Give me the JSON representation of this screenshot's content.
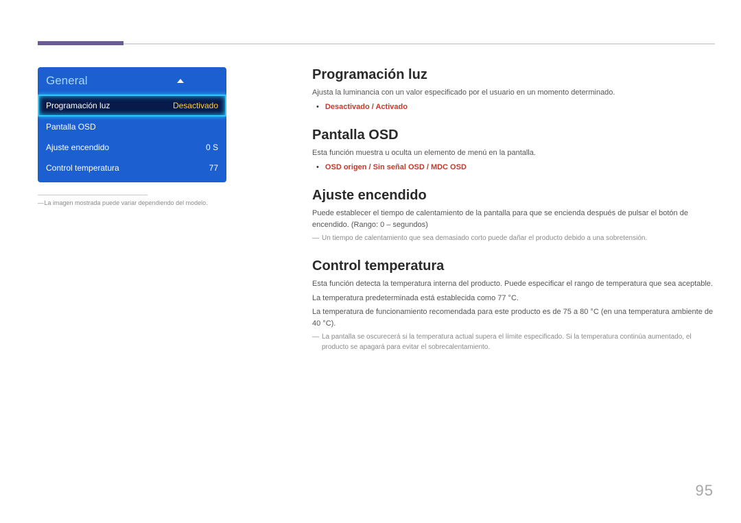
{
  "panel": {
    "title": "General",
    "rows": [
      {
        "label": "Programación luz",
        "value": "Desactivado"
      },
      {
        "label": "Pantalla OSD",
        "value": ""
      },
      {
        "label": "Ajuste encendido",
        "value": "0 S"
      },
      {
        "label": "Control temperatura",
        "value": "77"
      }
    ],
    "caption": "La imagen mostrada puede variar dependiendo del modelo."
  },
  "sections": {
    "prog_luz": {
      "title": "Programación luz",
      "desc": "Ajusta la luminancia con un valor especificado por el usuario en un momento determinado.",
      "options": "Desactivado / Activado"
    },
    "pantalla_osd": {
      "title": "Pantalla OSD",
      "desc": "Esta función muestra u oculta un elemento de menú en la pantalla.",
      "options": "OSD origen / Sin señal OSD / MDC OSD"
    },
    "ajuste_enc": {
      "title": "Ajuste encendido",
      "desc": "Puede establecer el tiempo de calentamiento de la pantalla para que se encienda después de pulsar el botón de encendido. (Rango: 0 – segundos)",
      "note": "Un tiempo de calentamiento que sea demasiado corto puede dañar el producto debido a una sobretensión."
    },
    "control_temp": {
      "title": "Control temperatura",
      "desc1": "Esta función detecta la temperatura interna del producto. Puede especificar el rango de temperatura que sea aceptable.",
      "desc2": "La temperatura predeterminada está establecida como 77 °C.",
      "desc3": "La temperatura de funcionamiento recomendada para este producto es de 75 a 80 °C (en una temperatura ambiente de 40 °C).",
      "note": "La pantalla se oscurecerá si la temperatura actual supera el límite especificado. Si la temperatura continúa aumentado, el producto se apagará para evitar el sobrecalentamiento."
    }
  },
  "page_number": "95"
}
